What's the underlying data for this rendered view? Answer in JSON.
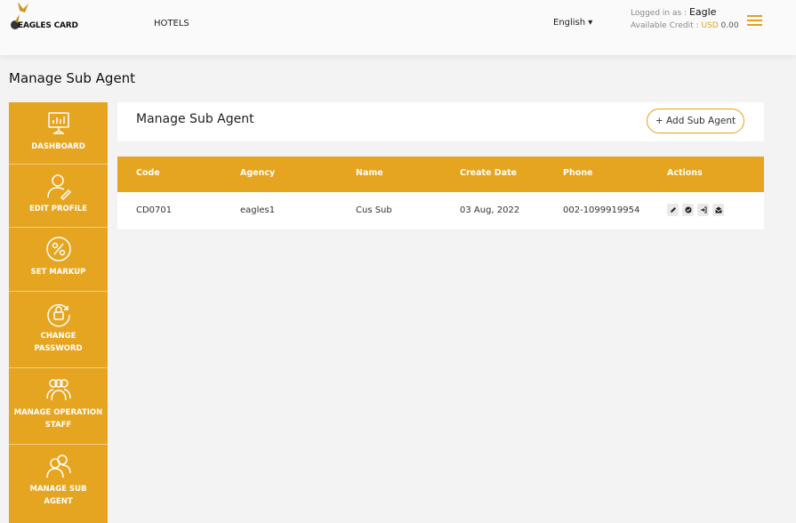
{
  "header": {
    "brand": "EAGLES CARD",
    "nav_hotels": "HOTELS",
    "language": "English ▾",
    "logged_in_label": "Logged in as :",
    "username": "Eagle",
    "credit_label": "Available Credit :",
    "currency": "USD",
    "credit_amount": "0.00",
    "menu_icon": "hamburger-icon"
  },
  "page_title": "Manage Sub Agent",
  "sidebar": {
    "items": [
      {
        "label": "DASHBOARD",
        "icon": "dashboard-icon"
      },
      {
        "label": "EDIT PROFILE",
        "icon": "user-edit-icon"
      },
      {
        "label": "SET MARKUP",
        "icon": "percent-icon"
      },
      {
        "label": "CHANGE PASSWORD",
        "icon": "lock-icon"
      },
      {
        "label": "MANAGE OPERATION STAFF",
        "icon": "users-group-icon"
      },
      {
        "label": "MANAGE SUB AGENT",
        "icon": "users-icon"
      }
    ]
  },
  "panel": {
    "title": "Manage Sub Agent",
    "add_button": "+ Add Sub Agent"
  },
  "table": {
    "columns": [
      "Code",
      "Agency",
      "Name",
      "Create Date",
      "Phone",
      "Actions"
    ],
    "rows": [
      {
        "code": "CD0701",
        "agency": "eagles1",
        "name": "Cus Sub",
        "create_date": "03 Aug, 2022",
        "phone": "002-1099919954",
        "actions": [
          "edit-icon",
          "check-icon",
          "login-icon",
          "mail-icon"
        ]
      }
    ]
  },
  "colors": {
    "accent": "#e5a520",
    "background": "#f3f3f3"
  }
}
